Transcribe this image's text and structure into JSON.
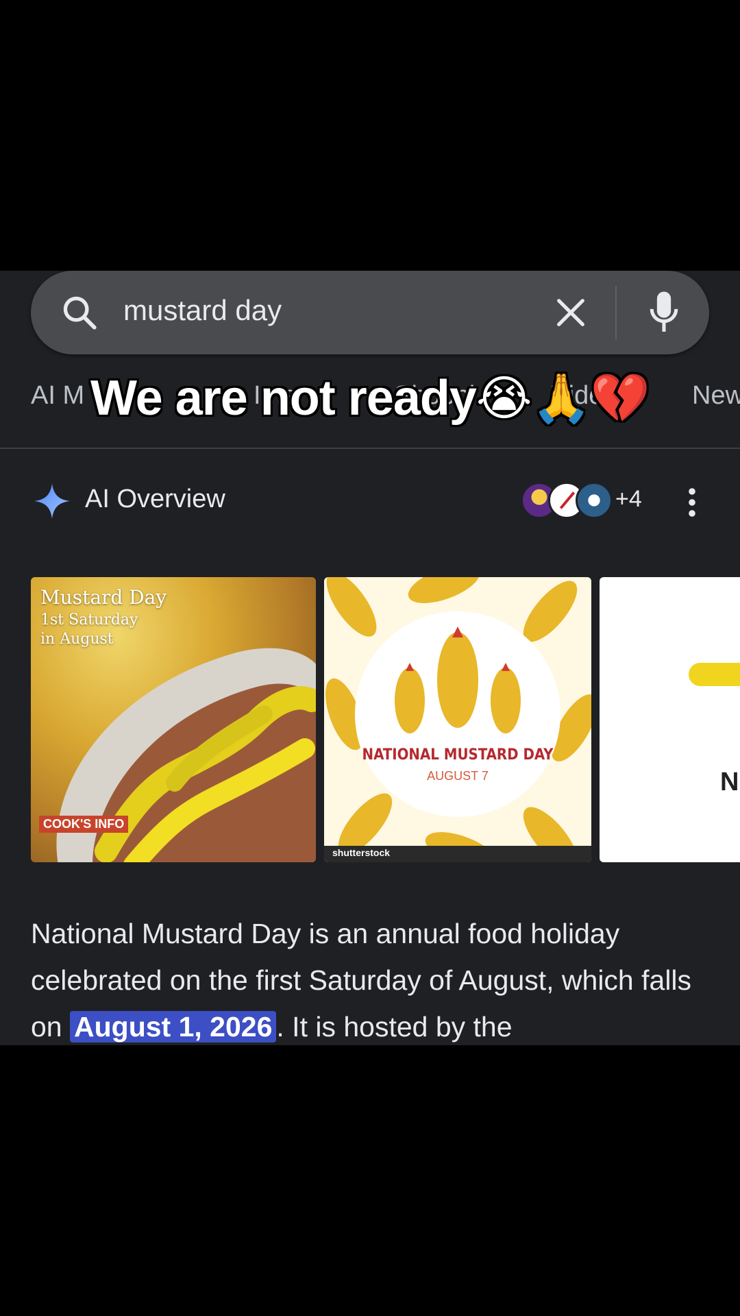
{
  "search": {
    "query": "mustard day"
  },
  "tabs": [
    {
      "label": "AI M"
    },
    {
      "label": "Ima"
    },
    {
      "label": "Shoppi"
    },
    {
      "label": "Vide"
    },
    {
      "label": "New"
    }
  ],
  "caption": {
    "text": "We are not ready",
    "emojis": "😭🙏💔"
  },
  "ai_overview": {
    "title": "AI Overview",
    "more_sources": "+4"
  },
  "images": [
    {
      "line1": "Mustard Day",
      "line2": "1st Saturday",
      "line3": "in August",
      "logo": "COOK'S INFO"
    },
    {
      "badge": "MUSTARD",
      "title": "NATIONAL MUSTARD DAY",
      "date": "AUGUST 7",
      "watermark": "shutterstock"
    },
    {
      "text": "N"
    }
  ],
  "overview_text": {
    "before": "National Mustard Day is an annual food holiday celebrated on the first Saturday of August, which falls on ",
    "highlight": "August 1, 2026",
    "after": ". It is hosted by the"
  },
  "colors": {
    "screen_bg": "#1f2023",
    "search_bg": "#4a4b4f",
    "highlight_bg": "#3c4fc4",
    "mustard": "#e8b72a",
    "sparkle": "#8ab4f8"
  }
}
